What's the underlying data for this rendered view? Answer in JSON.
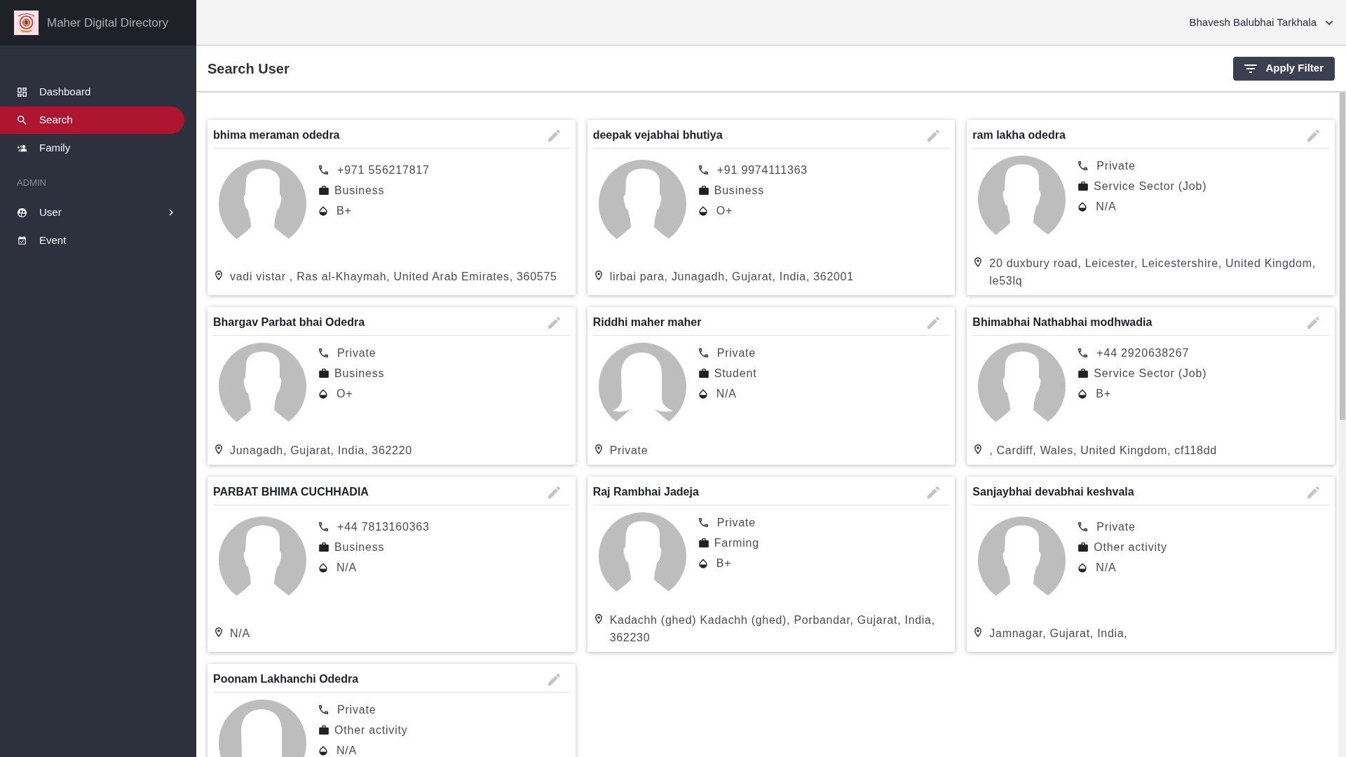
{
  "sidebar": {
    "brand": "Maher Digital Directory",
    "sections": [
      {
        "items": [
          {
            "label": "Dashboard",
            "selected": false
          },
          {
            "label": "Search",
            "selected": true
          },
          {
            "label": "Family",
            "selected": false
          }
        ]
      },
      {
        "heading": "ADMIN",
        "items": [
          {
            "label": "User",
            "selected": false,
            "expanded": false
          },
          {
            "label": "Event",
            "selected": false
          }
        ]
      }
    ]
  },
  "header": {
    "user_name": "Bhavesh Balubhai Tarkhala"
  },
  "page": {
    "title": "Search User",
    "filter_button": "Apply Filter"
  },
  "cards": [
    {
      "name": "bhima meraman odedra",
      "phone": "+971 556217817",
      "occupation": "Business",
      "blood_group": "B+",
      "address": "vadi vistar , Ras al-Khaymah, United Arab Emirates, 360575",
      "avatar": {
        "kind": "male"
      }
    },
    {
      "name": "deepak vejabhai bhutiya",
      "phone": "+91 9974111363",
      "occupation": "Business",
      "blood_group": "O+",
      "address": "lirbai para, Junagadh, Gujarat, India, 362001",
      "avatar": {
        "kind": "male"
      }
    },
    {
      "name": "ram lakha odedra",
      "phone": "Private",
      "occupation": "Service Sector (Job)",
      "blood_group": "N/A",
      "address": "20 duxbury road, Leicester, Leicestershire, United Kingdom, le53lq",
      "avatar": {
        "kind": "male"
      }
    },
    {
      "name": "Bhargav Parbat bhai Odedra",
      "phone": "Private",
      "occupation": "Business",
      "blood_group": "O+",
      "address": "Junagadh, Gujarat, India, 362220",
      "avatar": {
        "kind": "male"
      }
    },
    {
      "name": "Riddhi maher maher",
      "phone": "Private",
      "occupation": "Student",
      "blood_group": "N/A",
      "address": "Private",
      "avatar": {
        "kind": "female"
      }
    },
    {
      "name": "Bhimabhai Nathabhai modhwadia",
      "phone": "+44 2920638267",
      "occupation": "Service Sector (Job)",
      "blood_group": "B+",
      "address": ", Cardiff, Wales, United Kingdom, cf118dd",
      "avatar": {
        "kind": "male"
      }
    },
    {
      "name": "PARBAT BHIMA CUCHHADIA",
      "phone": "+44 7813160363",
      "occupation": "Business",
      "blood_group": "N/A",
      "address": "N/A",
      "avatar": {
        "kind": "male"
      }
    },
    {
      "name": "Raj Rambhai Jadeja",
      "phone": "Private",
      "occupation": "Farming",
      "blood_group": "B+",
      "address": "Kadachh (ghed) Kadachh (ghed), Porbandar, Gujarat, India, 362230",
      "avatar": {
        "kind": "male"
      }
    },
    {
      "name": "Sanjaybhai devabhai keshvala",
      "phone": "Private",
      "occupation": "Other activity",
      "blood_group": "N/A",
      "address": "Jamnagar, Gujarat, India,",
      "avatar": {
        "kind": "male"
      }
    },
    {
      "name": "Poonam Lakhanchi Odedra",
      "phone": "Private",
      "occupation": "Other activity",
      "blood_group": "N/A",
      "avatar": {
        "kind": "female"
      }
    }
  ]
}
